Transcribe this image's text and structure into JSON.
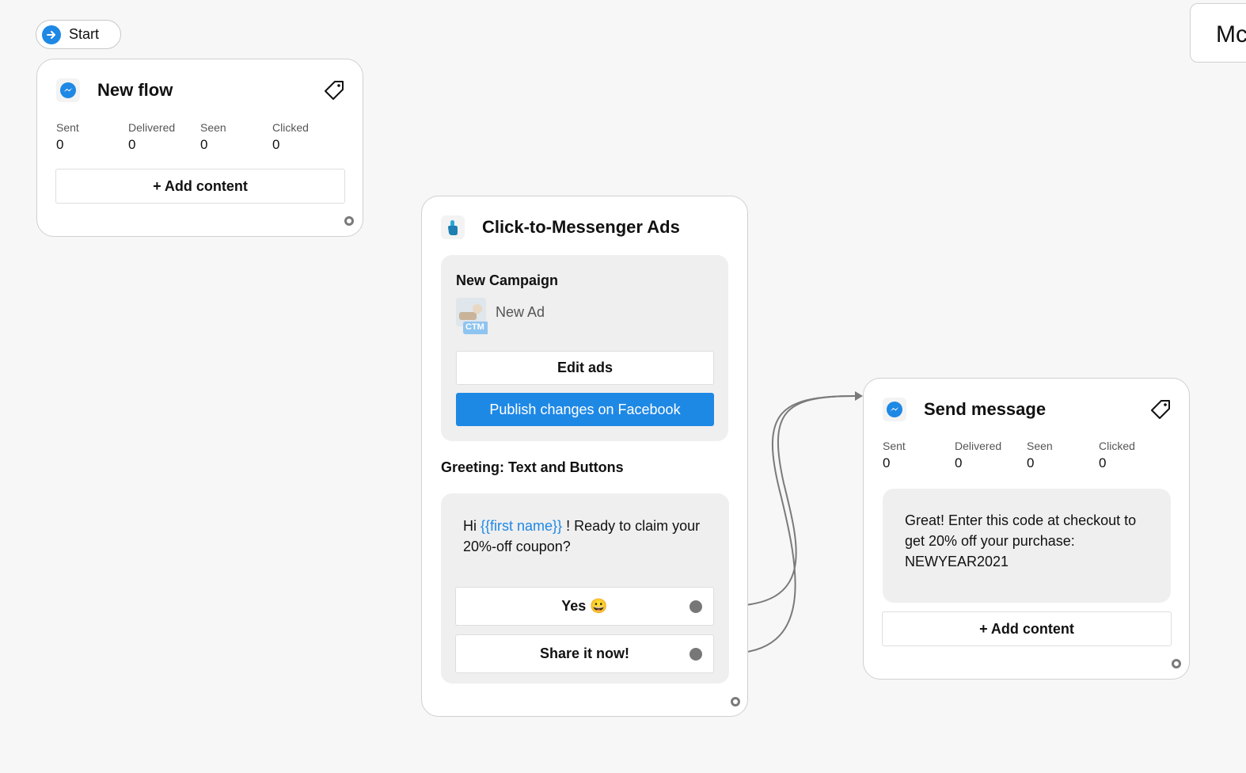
{
  "start": {
    "label": "Start"
  },
  "partial_card": {
    "text": "Mc"
  },
  "new_flow": {
    "title": "New flow",
    "stats": [
      {
        "label": "Sent",
        "value": "0"
      },
      {
        "label": "Delivered",
        "value": "0"
      },
      {
        "label": "Seen",
        "value": "0"
      },
      {
        "label": "Clicked",
        "value": "0"
      }
    ],
    "add_content": "+ Add content"
  },
  "ctm": {
    "title": "Click-to-Messenger Ads",
    "campaign": "New Campaign",
    "ad_name": "New Ad",
    "ad_badge": "CTM",
    "edit_ads": "Edit ads",
    "publish": "Publish changes on Facebook",
    "greeting_title": "Greeting: Text and Buttons",
    "greeting_prefix": "Hi ",
    "greeting_var": "{{first name}}",
    "greeting_suffix": " ! Ready to claim your 20%-off coupon?",
    "buttons": [
      {
        "label": "Yes 😀"
      },
      {
        "label": "Share it now!"
      }
    ]
  },
  "send_message": {
    "title": "Send message",
    "stats": [
      {
        "label": "Sent",
        "value": "0"
      },
      {
        "label": "Delivered",
        "value": "0"
      },
      {
        "label": "Seen",
        "value": "0"
      },
      {
        "label": "Clicked",
        "value": "0"
      }
    ],
    "message": "Great! Enter this code at checkout to get 20% off your purchase: NEWYEAR2021",
    "add_content": "+ Add content"
  },
  "icons": {
    "start": "arrow-right-icon",
    "messenger": "messenger-icon",
    "tag": "tag-icon",
    "ctm": "pointer-hand-icon",
    "ad_thumb": "ad-thumbnail-icon"
  },
  "colors": {
    "accent": "#1e88e5",
    "canvas": "#f7f7f7",
    "panel": "#efefef",
    "connector": "#7a7a7a"
  }
}
